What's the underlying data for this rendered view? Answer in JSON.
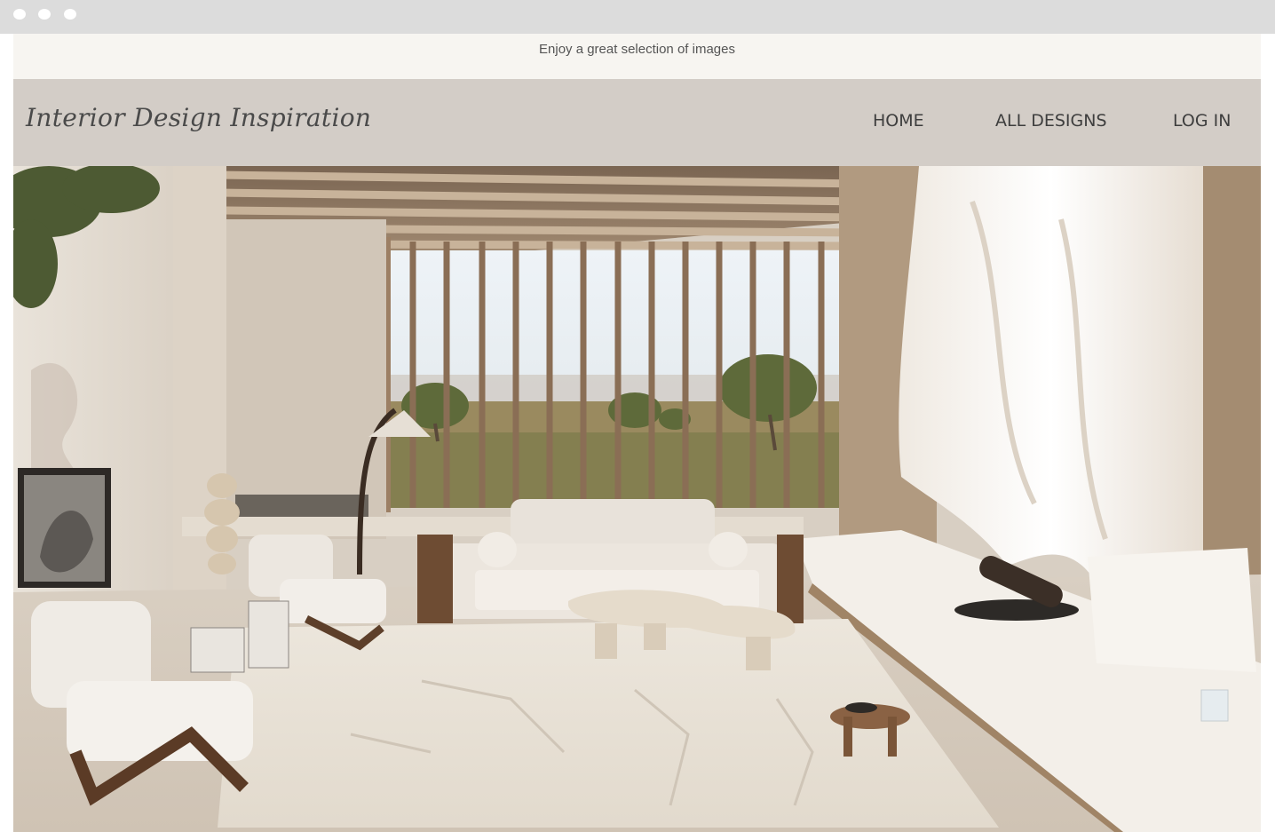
{
  "window": {
    "controls": [
      "close-dot",
      "minimize-dot",
      "maximize-dot"
    ]
  },
  "announcement": {
    "text": "Enjoy a great selection of images"
  },
  "header": {
    "logo": "Interior Design Inspiration",
    "nav": [
      {
        "label": "HOME"
      },
      {
        "label": "ALL DESIGNS"
      },
      {
        "label": "LOG IN"
      }
    ]
  },
  "hero": {
    "image": "interior-living-room-photo"
  },
  "colors": {
    "announcement_bg": "#f7f5f1",
    "header_bg": "#d3cdc7",
    "nav_text": "#3e3e3e",
    "chrome_bg": "#dcdcdc"
  }
}
